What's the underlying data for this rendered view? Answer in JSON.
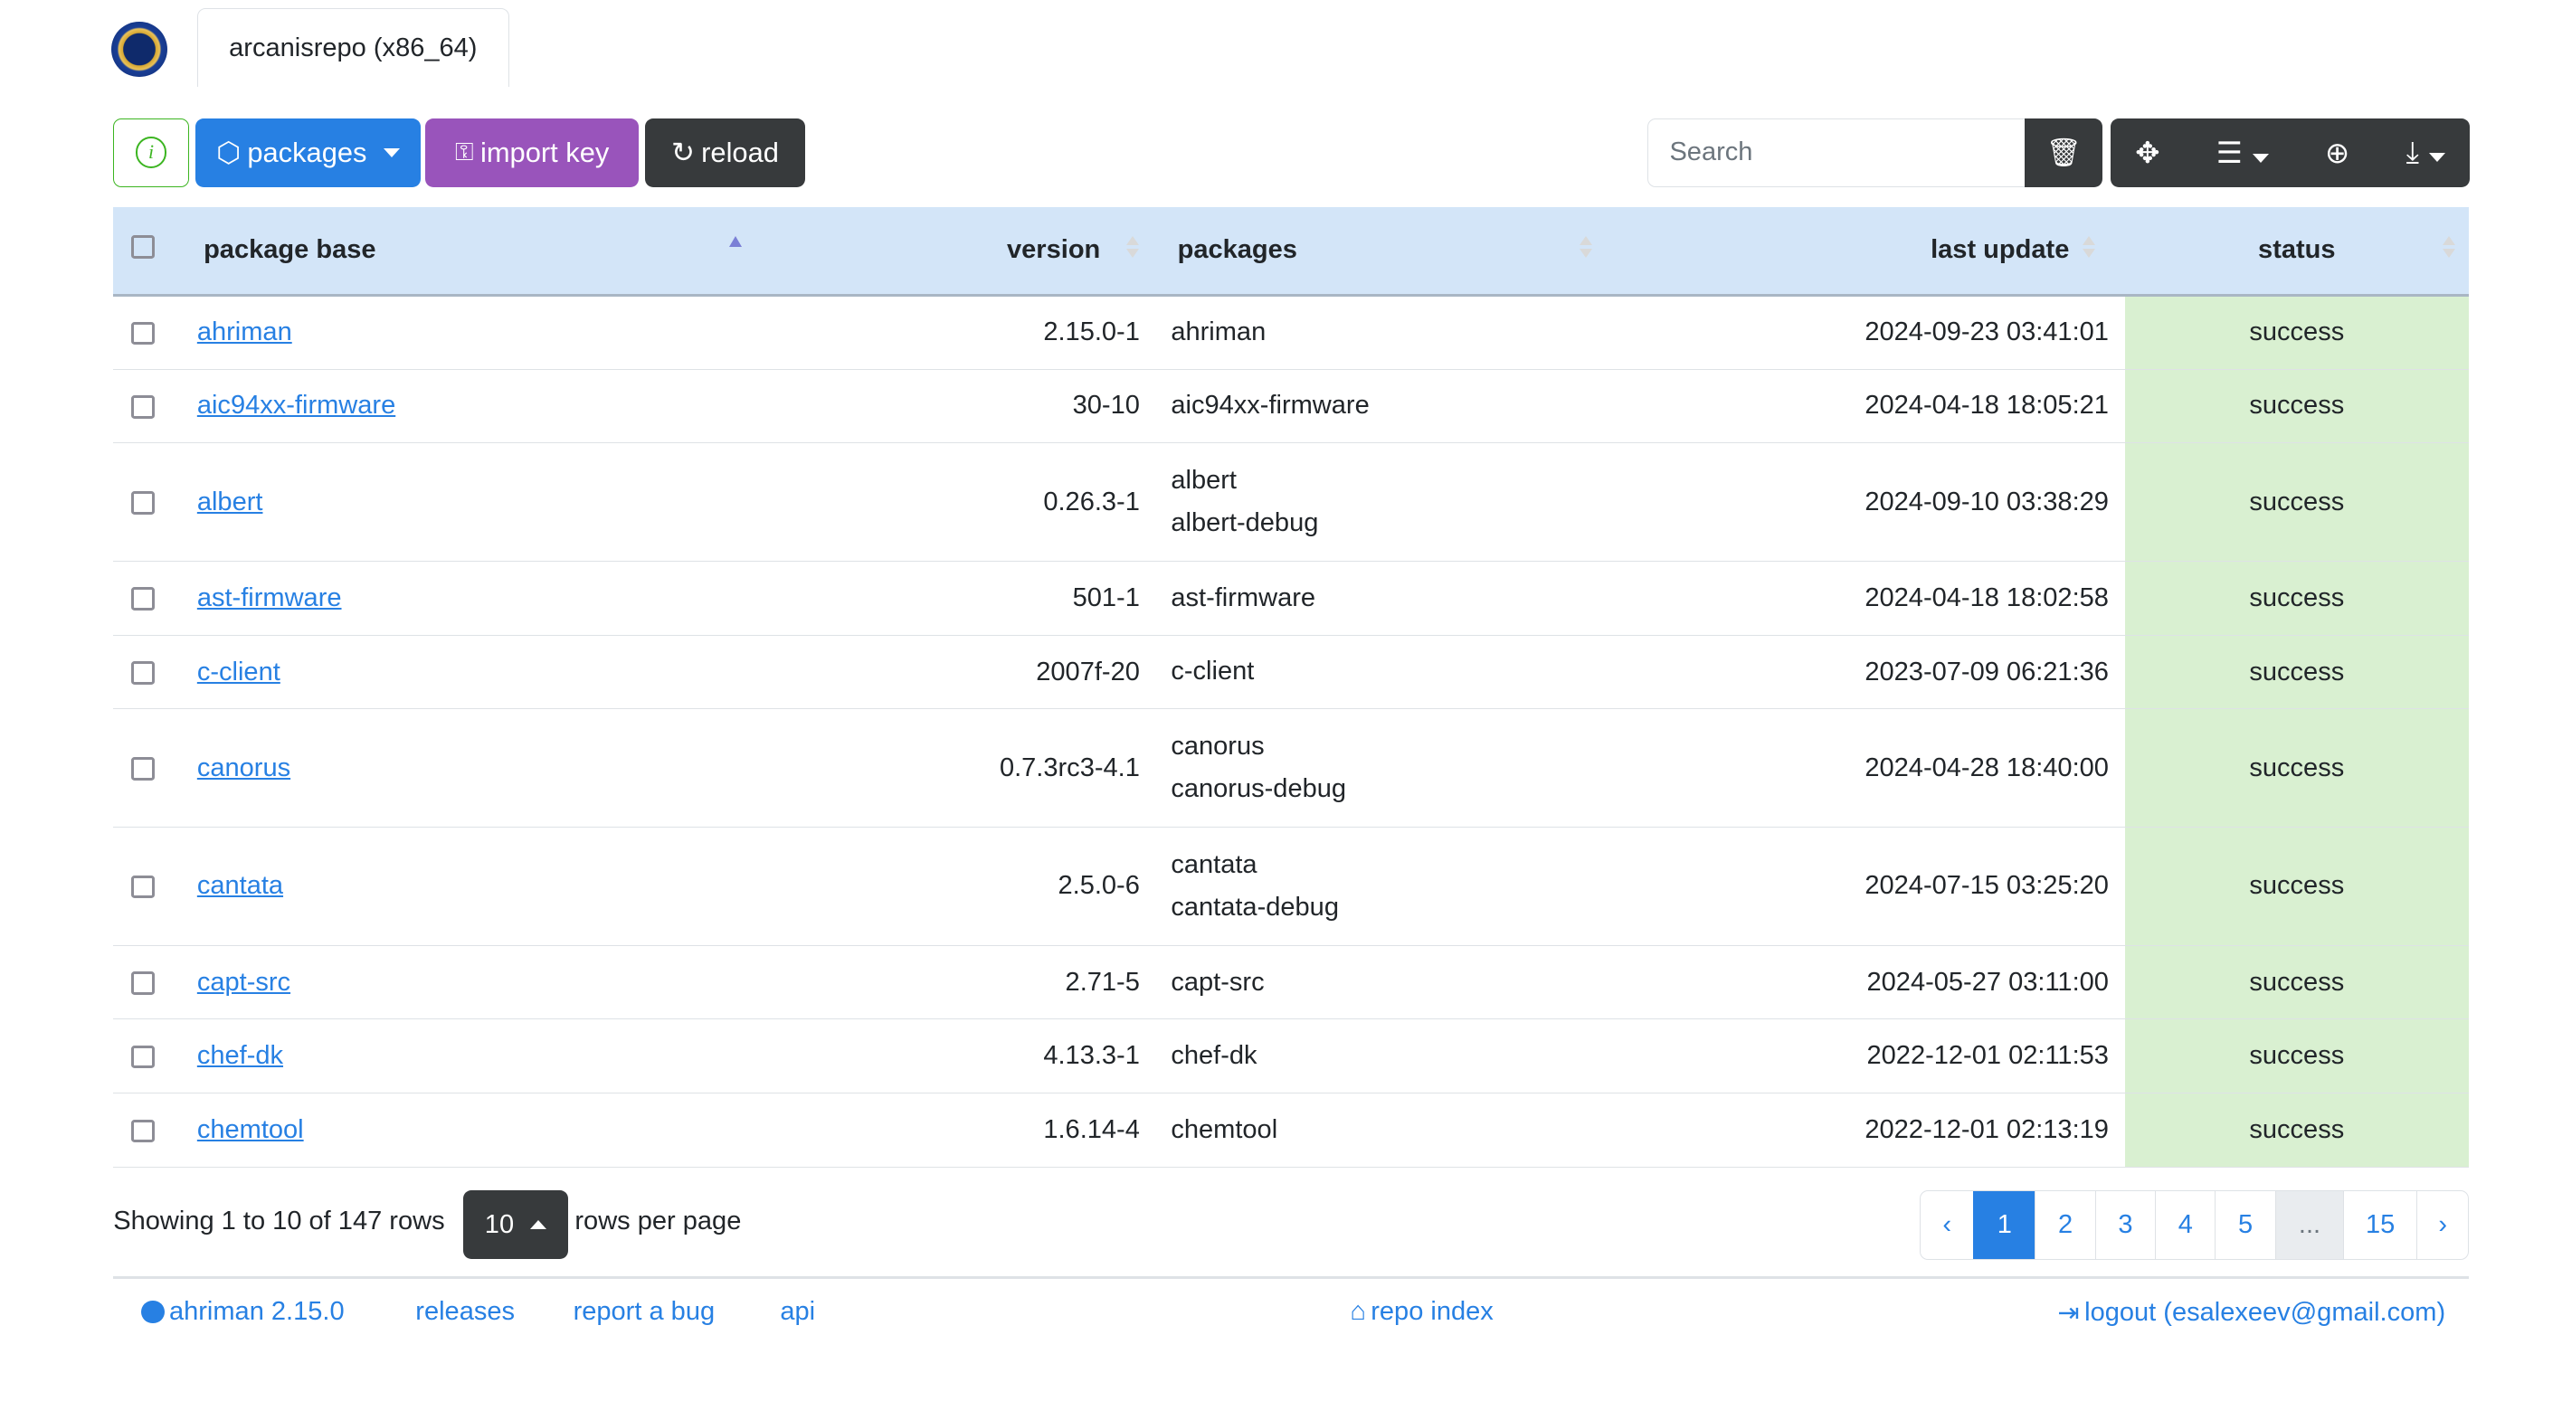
{
  "header": {
    "repo_tab": "arcanisrepo (x86_64)"
  },
  "toolbar": {
    "packages_label": "packages",
    "import_key_label": "import key",
    "reload_label": "reload",
    "search_placeholder": "Search"
  },
  "colors": {
    "info": "#3cb521",
    "primary": "#2780e3",
    "purple": "#9954bb",
    "dark": "#373a3c",
    "header_bg": "#d3e5f8",
    "success_bg": "#d9f0d1"
  },
  "table": {
    "columns": [
      "package base",
      "version",
      "packages",
      "last update",
      "status"
    ],
    "sort": {
      "column": "package base",
      "direction": "asc"
    },
    "rows": [
      {
        "base": "ahriman",
        "version": "2.15.0-1",
        "packages": [
          "ahriman"
        ],
        "updated": "2024-09-23 03:41:01",
        "status": "success"
      },
      {
        "base": "aic94xx-firmware",
        "version": "30-10",
        "packages": [
          "aic94xx-firmware"
        ],
        "updated": "2024-04-18 18:05:21",
        "status": "success"
      },
      {
        "base": "albert",
        "version": "0.26.3-1",
        "packages": [
          "albert",
          "albert-debug"
        ],
        "updated": "2024-09-10 03:38:29",
        "status": "success"
      },
      {
        "base": "ast-firmware",
        "version": "501-1",
        "packages": [
          "ast-firmware"
        ],
        "updated": "2024-04-18 18:02:58",
        "status": "success"
      },
      {
        "base": "c-client",
        "version": "2007f-20",
        "packages": [
          "c-client"
        ],
        "updated": "2023-07-09 06:21:36",
        "status": "success"
      },
      {
        "base": "canorus",
        "version": "0.7.3rc3-4.1",
        "packages": [
          "canorus",
          "canorus-debug"
        ],
        "updated": "2024-04-28 18:40:00",
        "status": "success"
      },
      {
        "base": "cantata",
        "version": "2.5.0-6",
        "packages": [
          "cantata",
          "cantata-debug"
        ],
        "updated": "2024-07-15 03:25:20",
        "status": "success"
      },
      {
        "base": "capt-src",
        "version": "2.71-5",
        "packages": [
          "capt-src"
        ],
        "updated": "2024-05-27 03:11:00",
        "status": "success"
      },
      {
        "base": "chef-dk",
        "version": "4.13.3-1",
        "packages": [
          "chef-dk"
        ],
        "updated": "2022-12-01 02:11:53",
        "status": "success"
      },
      {
        "base": "chemtool",
        "version": "1.6.14-4",
        "packages": [
          "chemtool"
        ],
        "updated": "2022-12-01 02:13:19",
        "status": "success"
      }
    ]
  },
  "pagination": {
    "showing": "Showing 1 to 10 of 147 rows",
    "page_size": "10",
    "rows_per_page": "rows per page",
    "prev": "‹",
    "pages": [
      "1",
      "2",
      "3",
      "4",
      "5",
      "...",
      "15"
    ],
    "next": "›",
    "current": "1"
  },
  "footer": {
    "version_link": "ahriman 2.15.0",
    "releases": "releases",
    "report_bug": "report a bug",
    "api": "api",
    "repo_index": "repo index",
    "logout": "logout (esalexeev@gmail.com)"
  }
}
